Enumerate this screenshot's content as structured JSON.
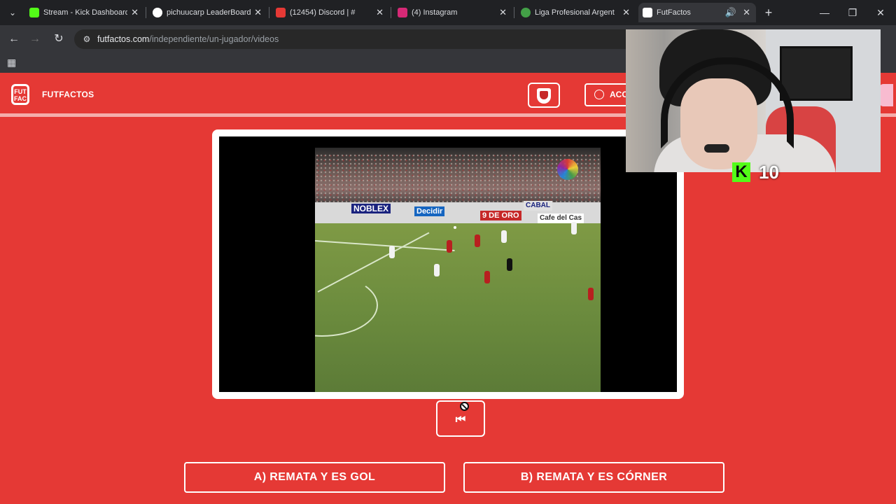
{
  "browser": {
    "tabs": [
      {
        "title": "Stream - Kick Dashboard",
        "favicon_color": "#53fc18",
        "favicon_icon": "kick-icon",
        "active": false
      },
      {
        "title": "pichuucarp LeaderBoard",
        "favicon_color": "#ffffff",
        "favicon_icon": "diamond-icon",
        "active": false
      },
      {
        "title": "(12454) Discord | #",
        "favicon_color": "#e53935",
        "favicon_icon": "discord-icon",
        "active": false
      },
      {
        "title": "(4) Instagram",
        "favicon_color": "#d62976",
        "favicon_icon": "instagram-icon",
        "active": false
      },
      {
        "title": "Liga Profesional Argent",
        "favicon_color": "#43a047",
        "favicon_icon": "ball-icon",
        "active": false
      },
      {
        "title": "FutFactos",
        "favicon_color": "#ffffff",
        "favicon_icon": "futfactos-icon",
        "active": true
      }
    ],
    "url_domain": "futfactos.com",
    "url_path": "/independiente/un-jugador/videos"
  },
  "site": {
    "brand": "FUTFACTOS",
    "logo_text": "FUT FAC",
    "access_label": "ACCE",
    "colors": {
      "accent": "#e53935",
      "frame": "#ffffff"
    }
  },
  "video": {
    "ad_noblex": "NOBLEX",
    "ad_decidir": "Decidir",
    "ad_oro": "9 DE ORO",
    "ad_cabal": "CABAL",
    "ad_cafe": "Cafe del Cas"
  },
  "replay": {
    "label": "⏮"
  },
  "answers": [
    {
      "label": "A) REMATA Y ES GOL"
    },
    {
      "label": "B) REMATA Y ES CÓRNER"
    }
  ],
  "overlay": {
    "kick_letter": "K",
    "kick_count": "10",
    "kick_color": "#53fc18"
  }
}
